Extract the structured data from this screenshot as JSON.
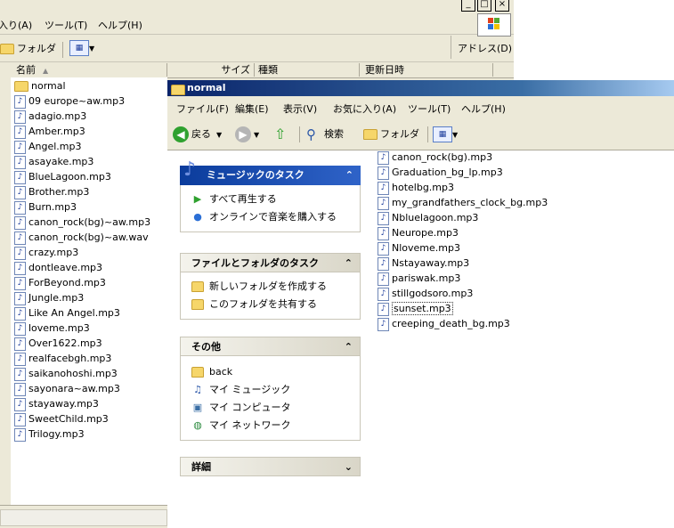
{
  "bg_window": {
    "menu": [
      "入り(A)",
      "ツール(T)",
      "ヘルプ(H)"
    ],
    "caption_buttons": [
      "_",
      "□",
      "×"
    ],
    "toolbar": {
      "folder_label": "フォルダ",
      "view_glyph": "▦",
      "address_label": "アドレス(D)"
    },
    "headers": {
      "name": "名前",
      "size": "サイズ",
      "type": "種類",
      "modified": "更新日時"
    },
    "files": [
      "normal",
      "09 europe~aw.mp3",
      "adagio.mp3",
      "Amber.mp3",
      "Angel.mp3",
      "asayake.mp3",
      "BlueLagoon.mp3",
      "Brother.mp3",
      "Burn.mp3",
      "canon_rock(bg)~aw.mp3",
      "canon_rock(bg)~aw.wav",
      "crazy.mp3",
      "dontleave.mp3",
      "ForBeyond.mp3",
      "Jungle.mp3",
      "Like An Angel.mp3",
      "loveme.mp3",
      "Over1622.mp3",
      "realfacebgh.mp3",
      "saikanohoshi.mp3",
      "sayonara~aw.mp3",
      "stayaway.mp3",
      "SweetChild.mp3",
      "Trilogy.mp3"
    ]
  },
  "front_window": {
    "title": "normal",
    "menu": [
      "ファイル(F)",
      "編集(E)",
      "表示(V)",
      "お気に入り(A)",
      "ツール(T)",
      "ヘルプ(H)"
    ],
    "toolbar": {
      "back": "戻る",
      "search": "検索",
      "folders": "フォルダ"
    },
    "music_tasks": {
      "title": "ミュージックのタスク",
      "items": [
        "すべて再生する",
        "オンラインで音楽を購入する"
      ]
    },
    "file_tasks": {
      "title": "ファイルとフォルダのタスク",
      "items": [
        "新しいフォルダを作成する",
        "このフォルダを共有する"
      ]
    },
    "other_places": {
      "title": "その他",
      "items": [
        "back",
        "マイ ミュージック",
        "マイ コンピュータ",
        "マイ ネットワーク"
      ]
    },
    "details": {
      "title": "詳細"
    },
    "files": [
      "canon_rock(bg).mp3",
      "Graduation_bg_lp.mp3",
      "hotelbg.mp3",
      "my_grandfathers_clock_bg.mp3",
      "Nbluelagoon.mp3",
      "Neurope.mp3",
      "Nloveme.mp3",
      "Nstayaway.mp3",
      "pariswak.mp3",
      "stillgodsoro.mp3",
      "sunset.mp3",
      "creeping_death_bg.mp3"
    ],
    "selected_file": "sunset.mp3"
  }
}
